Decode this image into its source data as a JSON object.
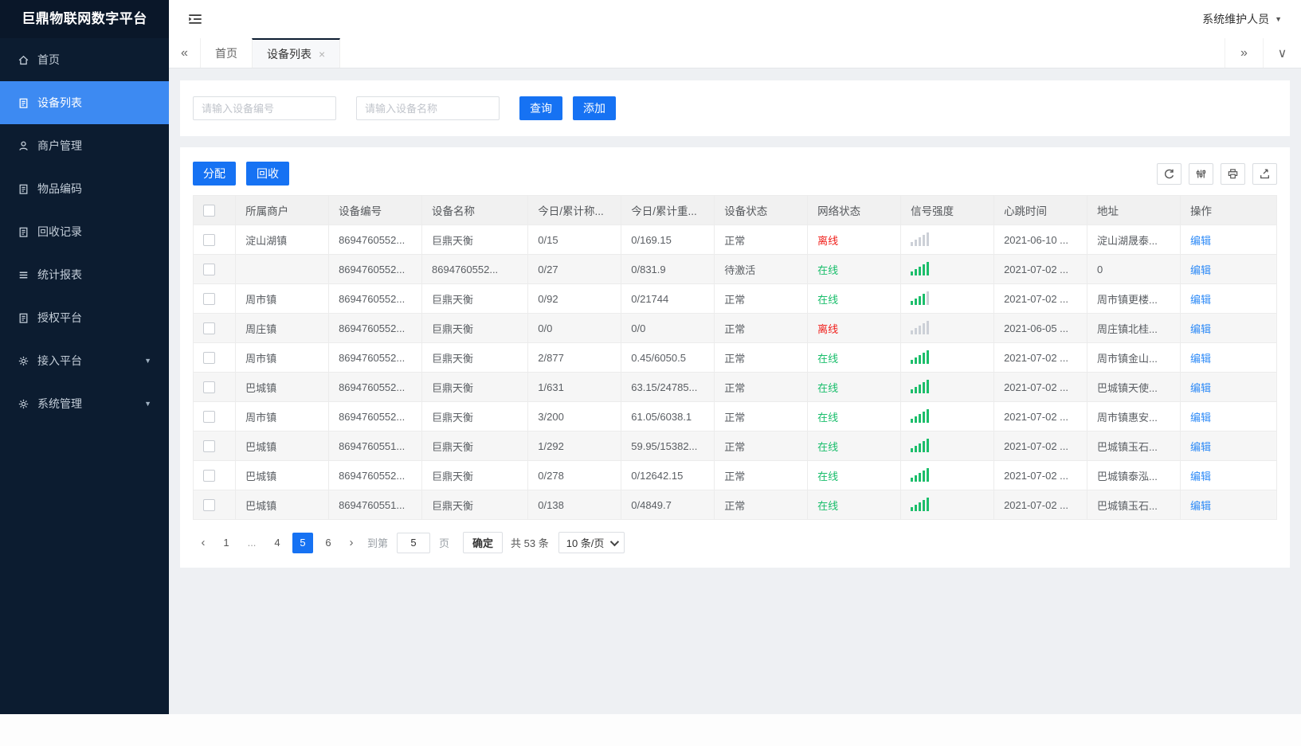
{
  "sidebar": {
    "title": "巨鼎物联网数字平台",
    "items": [
      {
        "label": "首页",
        "icon": "home-icon"
      },
      {
        "label": "设备列表",
        "icon": "device-list-icon",
        "active": true
      },
      {
        "label": "商户管理",
        "icon": "merchant-icon"
      },
      {
        "label": "物品编码",
        "icon": "item-code-icon"
      },
      {
        "label": "回收记录",
        "icon": "recycle-record-icon"
      },
      {
        "label": "统计报表",
        "icon": "report-icon"
      },
      {
        "label": "授权平台",
        "icon": "authorize-icon"
      },
      {
        "label": "接入平台",
        "icon": "gear-icon",
        "expandable": true
      },
      {
        "label": "系统管理",
        "icon": "gear-icon",
        "expandable": true
      }
    ]
  },
  "topbar": {
    "user_label": "系统维护人员"
  },
  "tabbar": {
    "tabs": [
      {
        "label": "首页"
      },
      {
        "label": "设备列表",
        "active": true,
        "close": "×"
      }
    ]
  },
  "search": {
    "device_no_placeholder": "请输入设备编号",
    "device_name_placeholder": "请输入设备名称",
    "query_label": "查询",
    "add_label": "添加"
  },
  "toolbar": {
    "assign_label": "分配",
    "recycle_label": "回收",
    "icon_buttons": [
      "refresh",
      "columns",
      "print",
      "export"
    ]
  },
  "table": {
    "columns": [
      "所属商户",
      "设备编号",
      "设备名称",
      "今日/累计称...",
      "今日/累计重...",
      "设备状态",
      "网络状态",
      "信号强度",
      "心跳时间",
      "地址",
      "操作"
    ],
    "action_label": "编辑",
    "rows": [
      {
        "merchant": "淀山湖镇",
        "device_no": "8694760552...",
        "device_name": "巨鼎天衡",
        "today_count": "0/15",
        "today_weight": "0/169.15",
        "device_status": "正常",
        "network_status": "离线",
        "online": false,
        "signal": 0,
        "heartbeat": "2021-06-10 ...",
        "address": "淀山湖晟泰..."
      },
      {
        "merchant": "",
        "device_no": "8694760552...",
        "device_name": "8694760552...",
        "today_count": "0/27",
        "today_weight": "0/831.9",
        "device_status": "待激活",
        "network_status": "在线",
        "online": true,
        "signal": 5,
        "heartbeat": "2021-07-02 ...",
        "address": "0"
      },
      {
        "merchant": "周市镇",
        "device_no": "8694760552...",
        "device_name": "巨鼎天衡",
        "today_count": "0/92",
        "today_weight": "0/21744",
        "device_status": "正常",
        "network_status": "在线",
        "online": true,
        "signal": 4,
        "heartbeat": "2021-07-02 ...",
        "address": "周市镇更楼..."
      },
      {
        "merchant": "周庄镇",
        "device_no": "8694760552...",
        "device_name": "巨鼎天衡",
        "today_count": "0/0",
        "today_weight": "0/0",
        "device_status": "正常",
        "network_status": "离线",
        "online": false,
        "signal": 0,
        "heartbeat": "2021-06-05 ...",
        "address": "周庄镇北桂..."
      },
      {
        "merchant": "周市镇",
        "device_no": "8694760552...",
        "device_name": "巨鼎天衡",
        "today_count": "2/877",
        "today_weight": "0.45/6050.5",
        "device_status": "正常",
        "network_status": "在线",
        "online": true,
        "signal": 5,
        "heartbeat": "2021-07-02 ...",
        "address": "周市镇金山..."
      },
      {
        "merchant": "巴城镇",
        "device_no": "8694760552...",
        "device_name": "巨鼎天衡",
        "today_count": "1/631",
        "today_weight": "63.15/24785...",
        "device_status": "正常",
        "network_status": "在线",
        "online": true,
        "signal": 5,
        "heartbeat": "2021-07-02 ...",
        "address": "巴城镇天使..."
      },
      {
        "merchant": "周市镇",
        "device_no": "8694760552...",
        "device_name": "巨鼎天衡",
        "today_count": "3/200",
        "today_weight": "61.05/6038.1",
        "device_status": "正常",
        "network_status": "在线",
        "online": true,
        "signal": 5,
        "heartbeat": "2021-07-02 ...",
        "address": "周市镇惠安..."
      },
      {
        "merchant": "巴城镇",
        "device_no": "8694760551...",
        "device_name": "巨鼎天衡",
        "today_count": "1/292",
        "today_weight": "59.95/15382...",
        "device_status": "正常",
        "network_status": "在线",
        "online": true,
        "signal": 5,
        "heartbeat": "2021-07-02 ...",
        "address": "巴城镇玉石..."
      },
      {
        "merchant": "巴城镇",
        "device_no": "8694760552...",
        "device_name": "巨鼎天衡",
        "today_count": "0/278",
        "today_weight": "0/12642.15",
        "device_status": "正常",
        "network_status": "在线",
        "online": true,
        "signal": 5,
        "heartbeat": "2021-07-02 ...",
        "address": "巴城镇泰泓..."
      },
      {
        "merchant": "巴城镇",
        "device_no": "8694760551...",
        "device_name": "巨鼎天衡",
        "today_count": "0/138",
        "today_weight": "0/4849.7",
        "device_status": "正常",
        "network_status": "在线",
        "online": true,
        "signal": 5,
        "heartbeat": "2021-07-02 ...",
        "address": "巴城镇玉石..."
      }
    ]
  },
  "pagination": {
    "pages": [
      "1",
      "...",
      "4",
      "5",
      "6"
    ],
    "active_page": "5",
    "jump_label": "到第",
    "jump_value": "5",
    "page_unit_label": "页",
    "confirm_label": "确定",
    "total_label": "共 53 条",
    "page_size_label": "10 条/页"
  },
  "colors": {
    "accent_blue": "#1672f3",
    "sidebar_active": "#3d8af2",
    "online_green": "#19be6b",
    "offline_red": "#f0211d",
    "edit_link_blue": "#2d8af7"
  }
}
